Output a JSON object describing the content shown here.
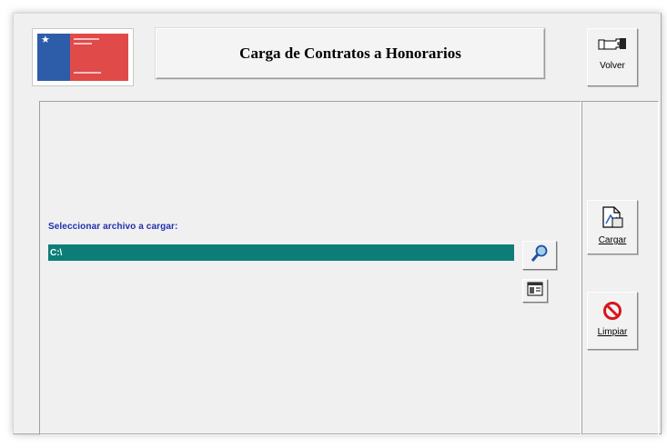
{
  "window": {
    "title": "Carga de Contratos a Honorarios"
  },
  "toolbar": {
    "volver_label": "Volver",
    "cargar_label": "Cargar",
    "limpiar_label": "Limpiar"
  },
  "form": {
    "file_label": "Seleccionar archivo a cargar:",
    "file_path": "C:\\"
  },
  "icons": {
    "volver": "pointing-hand-icon",
    "cargar": "document-icon",
    "limpiar": "no-entry-icon",
    "browse": "magnifier-icon",
    "viewer": "window-icon"
  },
  "colors": {
    "input_bg": "#0e7d78",
    "label_text": "#1f2fb0",
    "limpiar_icon": "#d8141c"
  }
}
